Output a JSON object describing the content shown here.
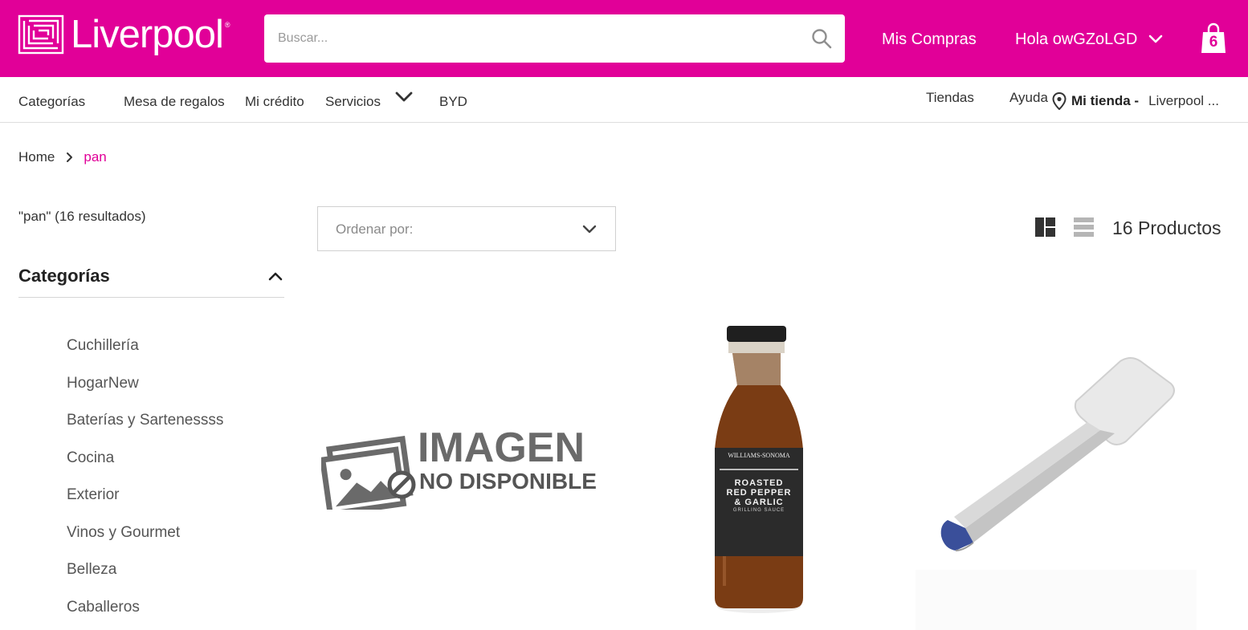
{
  "header": {
    "logo_text": "Liverpool",
    "logo_reg": "®",
    "search_placeholder": "Buscar...",
    "my_purchases": "Mis Compras",
    "greeting": "Hola owGZoLGD",
    "cart_count": "6",
    "brand_color": "#e10098"
  },
  "nav": {
    "items": [
      "Categorías",
      "Mesa de regalos",
      "Mi crédito",
      "Servicios",
      "BYD"
    ],
    "stores": "Tiendas",
    "help": "Ayuda",
    "my_store_label": "Mi tienda -",
    "my_store_name": "Liverpool ..."
  },
  "breadcrumb": {
    "home": "Home",
    "current": "pan"
  },
  "results_text": "\"pan\" (16 resultados)",
  "categories": {
    "title": "Categorías",
    "items": [
      "Cuchillería",
      "HogarNew",
      "Baterías y Sartenessss",
      "Cocina",
      "Exterior",
      "Vinos y Gourmet",
      "Belleza",
      "Caballeros"
    ]
  },
  "sort": {
    "label": "Ordenar por:"
  },
  "product_count": "16 Productos",
  "products": [
    {
      "image": "imagen-no-disponible",
      "placeholder_line1": "IMAGEN",
      "placeholder_line2": "NO DISPONIBLE"
    },
    {
      "image": "sauce-bottle",
      "label_brand": "WILLIAMS-SONOMA",
      "label_line1": "ROASTED",
      "label_line2": "RED PEPPER",
      "label_line3": "& GARLIC",
      "label_line4": "GRILLING SAUCE"
    },
    {
      "image": "grill-spatula"
    }
  ]
}
